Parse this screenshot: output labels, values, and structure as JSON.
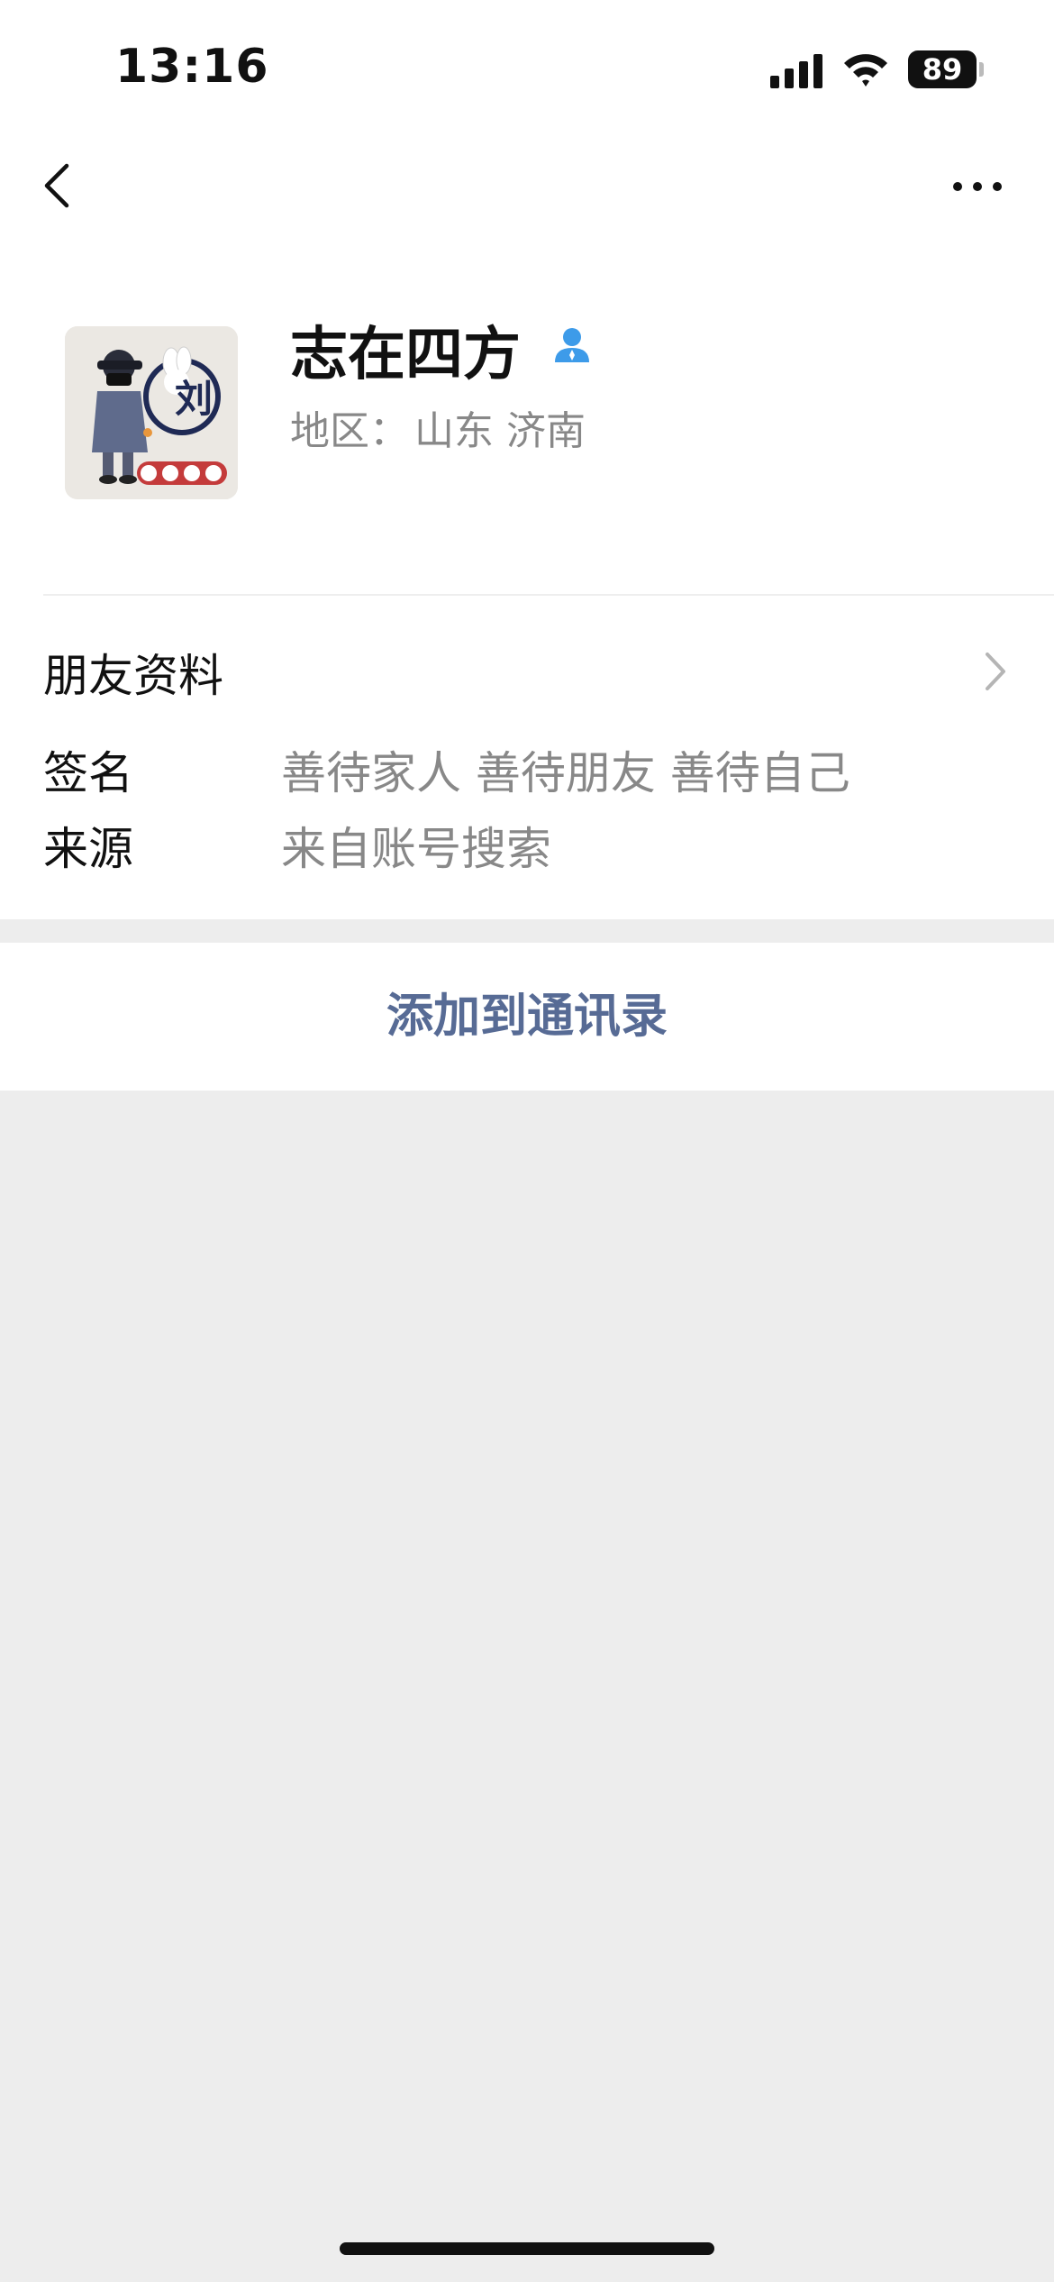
{
  "status_bar": {
    "time": "13:16",
    "battery": "89"
  },
  "profile": {
    "name": "志在四方",
    "region_label": "地区：",
    "region_value": "山东 济南"
  },
  "friend_info": {
    "label": "朋友资料"
  },
  "details": {
    "signature_label": "签名",
    "signature_value": "善待家人 善待朋友 善待自己",
    "source_label": "来源",
    "source_value": "来自账号搜索"
  },
  "actions": {
    "add_contact": "添加到通讯录"
  },
  "colors": {
    "link": "#576b95",
    "background": "#ededed",
    "verified": "#3d9be9"
  },
  "icons": [
    "back-icon",
    "more-icon",
    "verified-user-icon",
    "chevron-right-icon",
    "signal-icon",
    "wifi-icon",
    "battery-icon"
  ]
}
